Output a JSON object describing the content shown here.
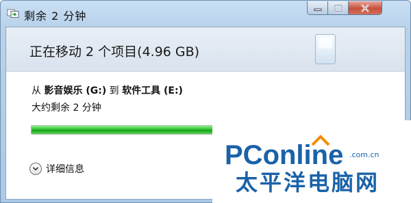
{
  "window": {
    "title": "剩余 2 分钟",
    "controls": {
      "minimize": "minimize-icon",
      "maximize": "maximize-icon",
      "close": "close-icon"
    }
  },
  "header": {
    "title": "正在移动 2 个项目(4.96 GB)"
  },
  "transfer": {
    "from_prefix": "从",
    "source": "影音娱乐 (G:)",
    "to_word": "到",
    "destination": "软件工具 (E:)",
    "time_remaining": "大约剩余 2 分钟",
    "progress_percent": 53
  },
  "details": {
    "label": "详细信息"
  },
  "watermark": {
    "brand": "PConline",
    "domain": ".com.cn",
    "chinese": "太平洋电脑网"
  },
  "colors": {
    "progress": "#2ec22e",
    "brand_blue": "#1a62a8",
    "brand_orange": "#f08c00"
  }
}
